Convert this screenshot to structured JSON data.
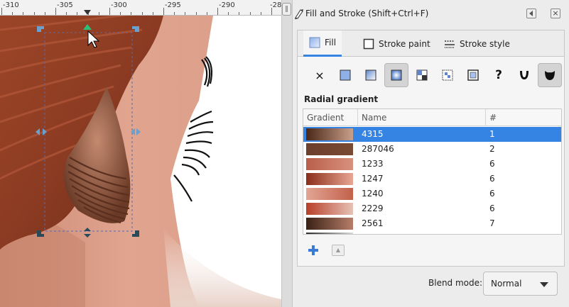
{
  "ruler": {
    "labels": [
      "-310",
      "-305",
      "-300",
      "-295",
      "-290",
      "-28"
    ]
  },
  "dialog": {
    "title": "Fill and Stroke (Shift+Ctrl+F)",
    "tabs": [
      {
        "label": "Fill",
        "icon": "fill-icon"
      },
      {
        "label": "Stroke paint",
        "icon": "stroke-paint-icon"
      },
      {
        "label": "Stroke style",
        "icon": "stroke-style-icon"
      }
    ],
    "paint_modes": [
      {
        "name": "no-paint-icon",
        "glyph": "×"
      },
      {
        "name": "flat-color-icon"
      },
      {
        "name": "linear-gradient-icon"
      },
      {
        "name": "radial-gradient-icon",
        "active": true
      },
      {
        "name": "pattern-icon"
      },
      {
        "name": "swatch-icon"
      },
      {
        "name": "mesh-gradient-icon"
      },
      {
        "name": "unset-paint-icon",
        "glyph": "?"
      },
      {
        "name": "fill-rule-evenodd-icon"
      },
      {
        "name": "fill-rule-nonzero-icon"
      }
    ],
    "section_label": "Radial gradient",
    "table": {
      "headers": [
        "Gradient",
        "Name",
        "#"
      ],
      "rows": [
        {
          "name": "4315",
          "count": "1",
          "selected": true,
          "from": "#4a2718",
          "to": "#c9a08a"
        },
        {
          "name": "287046",
          "count": "2",
          "from": "#6b3f2b",
          "to": "#7a4a33"
        },
        {
          "name": "1233",
          "count": "6",
          "from": "#b85f4a",
          "to": "#d8917e"
        },
        {
          "name": "1247",
          "count": "6",
          "from": "#8a2e1a",
          "to": "#e8a693"
        },
        {
          "name": "1240",
          "count": "6",
          "from": "#e2a594",
          "to": "#c2614b"
        },
        {
          "name": "2229",
          "count": "6",
          "from": "#b8402a",
          "to": "#e6c1b6"
        },
        {
          "name": "2561",
          "count": "7",
          "from": "#3a2116",
          "to": "#b67d68"
        }
      ]
    },
    "blend": {
      "label": "Blend mode:",
      "value": "Normal"
    }
  },
  "colors": {
    "accent": "#3584e4",
    "skin": "#dfa08a",
    "hair": "#8b3b22"
  }
}
